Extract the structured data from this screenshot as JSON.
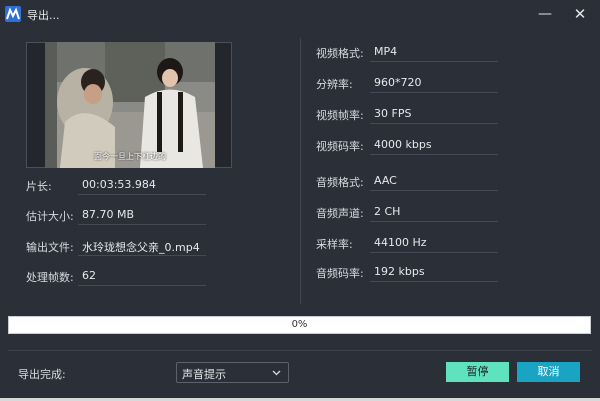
{
  "window": {
    "title": "导出...",
    "minimize_glyph": "—",
    "close_glyph": "✕"
  },
  "preview": {
    "subtitle": "面今一旦上下杠边的"
  },
  "left_info": [
    {
      "label": "片长:",
      "value": "00:03:53.984"
    },
    {
      "label": "估计大小:",
      "value": "87.70 MB"
    },
    {
      "label": "输出文件:",
      "value": "水玲珑想念父亲_0.mp4"
    },
    {
      "label": "处理帧数:",
      "value": "62"
    }
  ],
  "right_info": [
    {
      "label": "视频格式:",
      "value": "MP4"
    },
    {
      "label": "分辨率:",
      "value": "960*720"
    },
    {
      "label": "视频帧率:",
      "value": "30 FPS"
    },
    {
      "label": "视频码率:",
      "value": "4000 kbps"
    },
    {
      "label": "音频格式:",
      "value": "AAC"
    },
    {
      "label": "音频声道:",
      "value": "2 CH"
    },
    {
      "label": "采样率:",
      "value": "44100 Hz"
    },
    {
      "label": "音频码率:",
      "value": "192 kbps"
    }
  ],
  "progress": {
    "value": 0,
    "text": "0%"
  },
  "footer": {
    "done_label": "导出完成:",
    "done_action": "声音提示",
    "pause_label": "暂停",
    "cancel_label": "取消"
  },
  "colors": {
    "background": "#2b2f37",
    "accent_green": "#5fe3bd",
    "accent_blue": "#1aa4c4",
    "logo_blue": "#2f6fd6"
  }
}
